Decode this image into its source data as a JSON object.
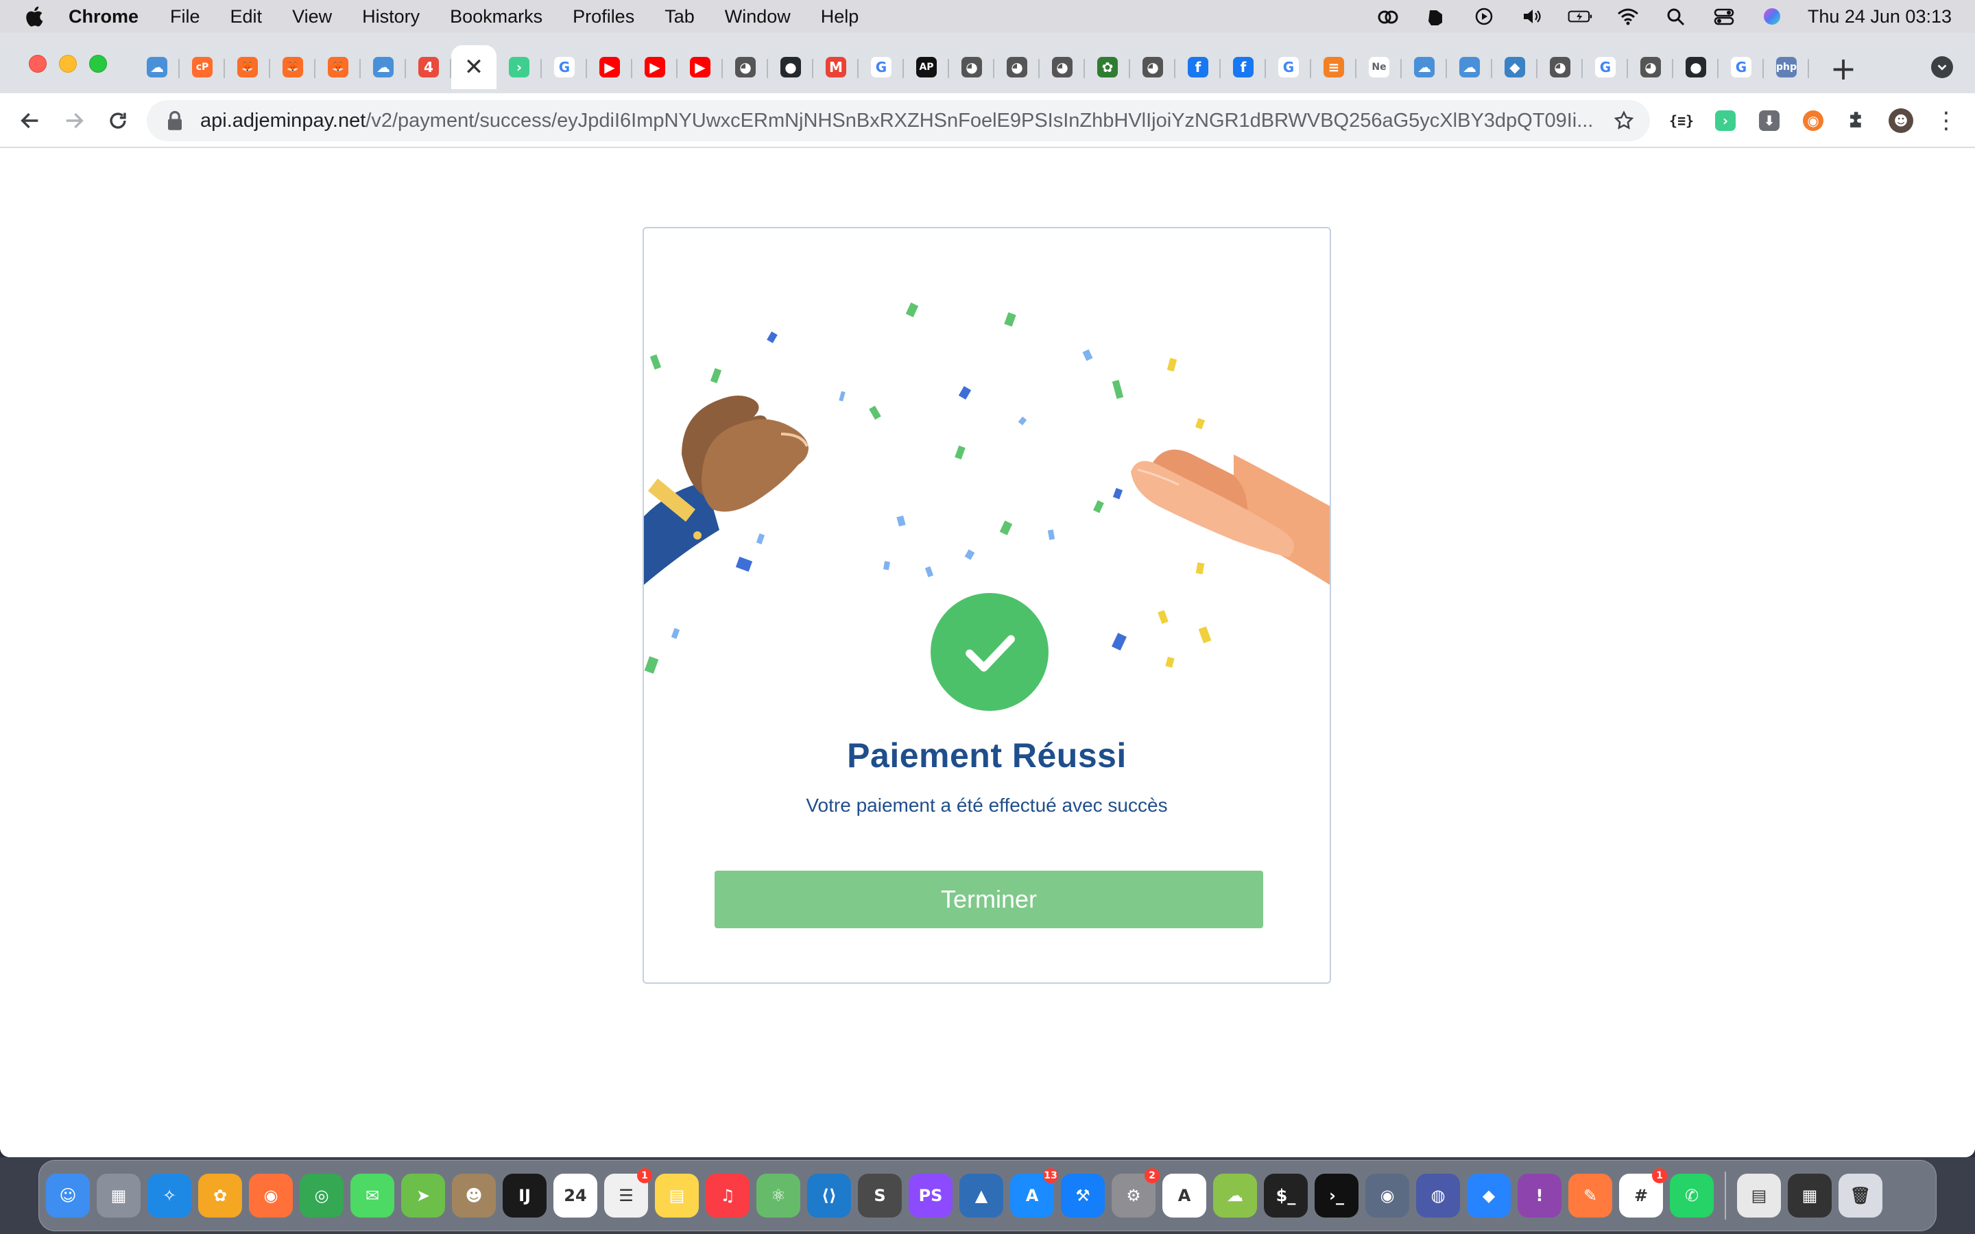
{
  "menubar": {
    "app": "Chrome",
    "items": [
      "File",
      "Edit",
      "View",
      "History",
      "Bookmarks",
      "Profiles",
      "Tab",
      "Window",
      "Help"
    ],
    "clock": "Thu 24 Jun  03:13",
    "status_icons": [
      "creative-cloud-icon",
      "evernote-icon",
      "play-icon",
      "volume-icon",
      "battery-icon",
      "wifi-icon",
      "spotlight-icon",
      "control-center-icon",
      "siri-icon"
    ]
  },
  "browser": {
    "url_host": "api.adjeminpay.net",
    "url_path": "/v2/payment/success/eyJpdiI6ImpNYUwxcERmNjNHSnBxRXZHSnFoelE9PSIsInZhbHVlIjoiYzNGR1dBRWVBQ256aG5ycXlBY3dpQT09Ii...",
    "tabs": [
      {
        "icon": "cloud-icon",
        "color": "#4a90d9",
        "glyph": "☁"
      },
      {
        "icon": "cpanel-icon",
        "color": "#ff6c2c",
        "glyph": "cP"
      },
      {
        "icon": "gitlab-icon",
        "color": "#fc6d26",
        "glyph": "🦊"
      },
      {
        "icon": "gitlab-icon",
        "color": "#fc6d26",
        "glyph": "🦊"
      },
      {
        "icon": "gitlab-icon",
        "color": "#fc6d26",
        "glyph": "🦊"
      },
      {
        "icon": "cloud-icon",
        "color": "#4a90d9",
        "glyph": "☁"
      },
      {
        "icon": "avatar-icon",
        "color": "#e94b3c",
        "glyph": "4"
      },
      {
        "icon": "close-icon",
        "color": "#ffffff",
        "glyph": "✕",
        "active": true
      },
      {
        "icon": "terminal-icon",
        "color": "#3ecf8e",
        "glyph": "›"
      },
      {
        "icon": "google-icon",
        "color": "#4285f4",
        "glyph": "G"
      },
      {
        "icon": "youtube-icon",
        "color": "#ff0000",
        "glyph": "▶"
      },
      {
        "icon": "youtube-icon",
        "color": "#ff0000",
        "glyph": "▶"
      },
      {
        "icon": "youtube-icon",
        "color": "#ff0000",
        "glyph": "▶"
      },
      {
        "icon": "bird-icon",
        "color": "#555555",
        "glyph": "◕"
      },
      {
        "icon": "github-icon",
        "color": "#24292e",
        "glyph": "●"
      },
      {
        "icon": "gmail-icon",
        "color": "#ea4335",
        "glyph": "M"
      },
      {
        "icon": "google-icon",
        "color": "#4285f4",
        "glyph": "G"
      },
      {
        "icon": "app-icon",
        "color": "#111111",
        "glyph": "AP"
      },
      {
        "icon": "bird-icon",
        "color": "#555555",
        "glyph": "◕"
      },
      {
        "icon": "bird-icon",
        "color": "#555555",
        "glyph": "◕"
      },
      {
        "icon": "bird-icon",
        "color": "#555555",
        "glyph": "◕"
      },
      {
        "icon": "gear-icon",
        "color": "#2e7d32",
        "glyph": "✿"
      },
      {
        "icon": "bird-icon",
        "color": "#555555",
        "glyph": "◕"
      },
      {
        "icon": "facebook-icon",
        "color": "#1877f2",
        "glyph": "f"
      },
      {
        "icon": "facebook-icon",
        "color": "#1877f2",
        "glyph": "f"
      },
      {
        "icon": "google-icon",
        "color": "#4285f4",
        "glyph": "G"
      },
      {
        "icon": "stackoverflow-icon",
        "color": "#f48024",
        "glyph": "≡"
      },
      {
        "icon": "text-tab",
        "color": "#5f6368",
        "glyph": "Ne"
      },
      {
        "icon": "cloud-icon",
        "color": "#4a90d9",
        "glyph": "☁"
      },
      {
        "icon": "cloud-icon",
        "color": "#4a90d9",
        "glyph": "☁"
      },
      {
        "icon": "box-icon",
        "color": "#3b82c4",
        "glyph": "◆"
      },
      {
        "icon": "bird-icon",
        "color": "#555555",
        "glyph": "◕"
      },
      {
        "icon": "google-icon",
        "color": "#4285f4",
        "glyph": "G"
      },
      {
        "icon": "bird-icon",
        "color": "#555555",
        "glyph": "◕"
      },
      {
        "icon": "github-icon",
        "color": "#24292e",
        "glyph": "●"
      },
      {
        "icon": "google-icon",
        "color": "#4285f4",
        "glyph": "G"
      },
      {
        "icon": "php-icon",
        "color": "#6181b6",
        "glyph": "php"
      }
    ]
  },
  "page": {
    "title": "Paiement Réussi",
    "subtitle": "Votre paiement a été effectué avec succès",
    "button_label": "Terminer",
    "colors": {
      "accent": "#4dc169",
      "title": "#1f4e8c",
      "button": "#7fc98b"
    }
  },
  "dock": {
    "apps": [
      {
        "name": "finder",
        "color": "#3d8ef0",
        "glyph": "☺"
      },
      {
        "name": "launchpad",
        "color": "#8a8f9c",
        "glyph": "▦"
      },
      {
        "name": "safari",
        "color": "#1e88e5",
        "glyph": "✧"
      },
      {
        "name": "photos",
        "color": "#f5a623",
        "glyph": "✿"
      },
      {
        "name": "firefox",
        "color": "#ff7139",
        "glyph": "◉"
      },
      {
        "name": "chrome",
        "color": "#34a853",
        "glyph": "◎"
      },
      {
        "name": "messages",
        "color": "#4cd964",
        "glyph": "✉"
      },
      {
        "name": "maps",
        "color": "#6cc04a",
        "glyph": "➤"
      },
      {
        "name": "contacts",
        "color": "#a2845e",
        "glyph": "☻"
      },
      {
        "name": "intellij",
        "color": "#1a1a1a",
        "glyph": "IJ"
      },
      {
        "name": "calendar",
        "color": "#ffffff",
        "glyph": "24",
        "dark": true
      },
      {
        "name": "reminders",
        "color": "#f0f0f0",
        "glyph": "☰",
        "badge": "1",
        "dark": true
      },
      {
        "name": "notes",
        "color": "#fdd64b",
        "glyph": "▤"
      },
      {
        "name": "music",
        "color": "#fc3c44",
        "glyph": "♫"
      },
      {
        "name": "atom",
        "color": "#66bb6a",
        "glyph": "⚛"
      },
      {
        "name": "vscode",
        "color": "#1e7acb",
        "glyph": "⟨⟩"
      },
      {
        "name": "sublime",
        "color": "#4a4a4a",
        "glyph": "S"
      },
      {
        "name": "phpstorm",
        "color": "#8c4bff",
        "glyph": "PS"
      },
      {
        "name": "affinity",
        "color": "#2f6db7",
        "glyph": "▲"
      },
      {
        "name": "app-store",
        "color": "#1a8cff",
        "glyph": "A",
        "badge": "13"
      },
      {
        "name": "xcode",
        "color": "#147efb",
        "glyph": "⚒"
      },
      {
        "name": "system-preferences",
        "color": "#8e8e93",
        "glyph": "⚙",
        "badge": "2"
      },
      {
        "name": "artstudio",
        "color": "#ffffff",
        "glyph": "A",
        "dark": true
      },
      {
        "name": "cloud-app",
        "color": "#8bc34a",
        "glyph": "☁"
      },
      {
        "name": "terminal",
        "color": "#222222",
        "glyph": "$_"
      },
      {
        "name": "iterm",
        "color": "#111111",
        "glyph": "›_"
      },
      {
        "name": "codeshot",
        "color": "#5b6b84",
        "glyph": "◉"
      },
      {
        "name": "proxyman",
        "color": "#4a5aa8",
        "glyph": "◍"
      },
      {
        "name": "jira",
        "color": "#2684ff",
        "glyph": "◆"
      },
      {
        "name": "feedback",
        "color": "#8e44ad",
        "glyph": "!"
      },
      {
        "name": "figma-pen",
        "color": "#ff7a3c",
        "glyph": "✎"
      },
      {
        "name": "slack",
        "color": "#ffffff",
        "glyph": "#",
        "badge": "1",
        "dark": true
      },
      {
        "name": "whatsapp",
        "color": "#25d366",
        "glyph": "✆"
      }
    ],
    "right": [
      {
        "name": "documents-stack",
        "color": "#e8e8e8",
        "glyph": "▤",
        "dark": true
      },
      {
        "name": "screenshots-stack",
        "color": "#333333",
        "glyph": "▦"
      },
      {
        "name": "trash",
        "color": "#d9dde3",
        "glyph": "🗑",
        "dark": true
      }
    ]
  }
}
